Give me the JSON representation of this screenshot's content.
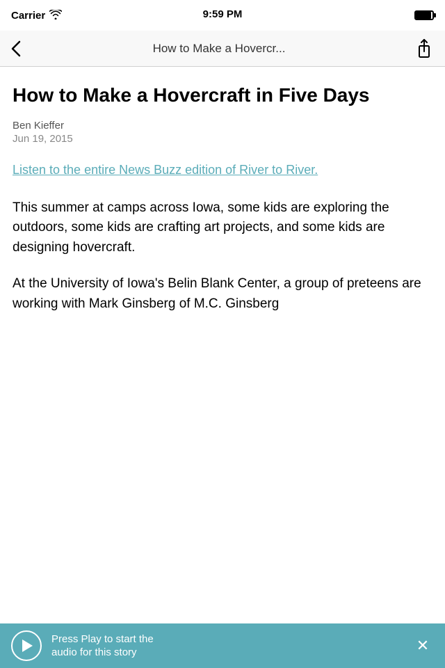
{
  "status_bar": {
    "carrier": "Carrier",
    "time": "9:59 PM"
  },
  "nav_bar": {
    "title": "How to Make a Hovercr...",
    "back_label": "‹",
    "share_label": "share"
  },
  "article": {
    "title": "How to Make a Hovercraft in Five Days",
    "author": "Ben Kieffer",
    "date": "Jun 19, 2015",
    "link_text": "Listen to the entire News Buzz edition of River to River.",
    "body_paragraph_1": "This summer at camps across Iowa, some kids are exploring the outdoors, some kids are crafting art projects, and some kids are designing hovercraft.",
    "body_paragraph_2": "At the University of Iowa's Belin Blank Center, a group of preteens are working with Mark Ginsberg of M.C. Ginsberg"
  },
  "audio_player": {
    "text_line1": "Press Play to start the",
    "text_line2": "audio for this story"
  }
}
